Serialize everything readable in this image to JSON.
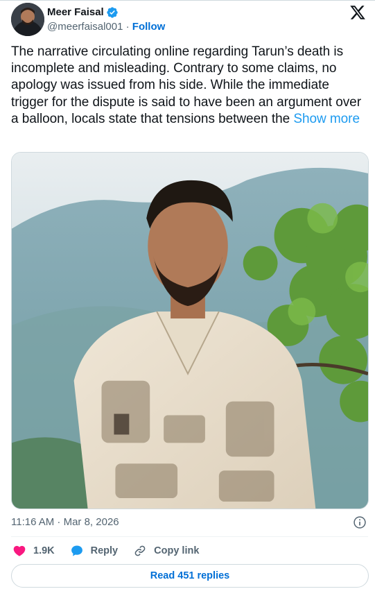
{
  "author": {
    "display_name": "Meer Faisal",
    "handle": "@meerfaisal001",
    "separator": "·",
    "follow_label": "Follow",
    "verified": true
  },
  "tweet": {
    "text": "The narrative circulating online regarding Tarun’s death is incomplete and misleading. Contrary to some claims, no apology was issued from his side. While the immediate trigger for the dispute is said to have been an argument over a balloon, locals state that tensions between the ",
    "show_more_label": "Show more",
    "timestamp": "11:16 AM · Mar 8, 2026"
  },
  "actions": {
    "likes": "1.9K",
    "reply_label": "Reply",
    "copy_link_label": "Copy link",
    "read_replies_label": "Read 451 replies"
  },
  "icons": {
    "verified": "verified-badge-icon",
    "brand": "x-logo-icon",
    "info": "info-icon",
    "like": "heart-icon",
    "reply": "speech-bubble-icon",
    "copy": "link-icon"
  },
  "colors": {
    "link": "#1d9bf0",
    "follow": "#006fd6",
    "heart": "#f91880",
    "reply_bubble": "#1d9bf0",
    "muted": "#536471"
  }
}
